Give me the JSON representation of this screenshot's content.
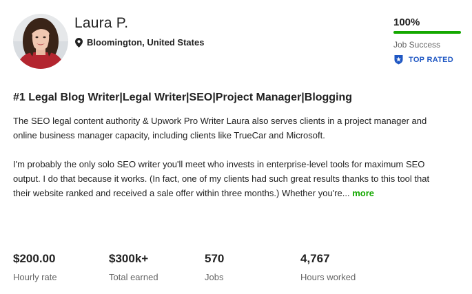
{
  "profile": {
    "name": "Laura P.",
    "location": "Bloomington, United States",
    "avatar_icon": "profile-photo"
  },
  "job_success": {
    "value_label": "100%",
    "percent": 100,
    "label": "Job Success",
    "bar_color": "#14a800"
  },
  "badge": {
    "label": "TOP RATED",
    "icon": "top-rated-shield-icon",
    "color": "#1f57c3"
  },
  "headline": "#1 Legal Blog Writer|Legal Writer|SEO|Project Manager|Blogging",
  "overview": {
    "paragraph1": "The SEO legal content authority & Upwork Pro Writer Laura also serves clients in a project manager and online business manager capacity, including clients like TrueCar and Microsoft.",
    "paragraph2": "I'm probably the only solo SEO writer you'll meet who invests in enterprise-level tools for maximum SEO output. I do that because it works. (In fact, one of my clients had such great results thanks to this tool that their website ranked and received a sale offer within three months.) Whether you're...",
    "more_label": "more",
    "link_color": "#14a800"
  },
  "stats": [
    {
      "value": "$200.00",
      "label": "Hourly rate"
    },
    {
      "value": "$300k+",
      "label": "Total earned"
    },
    {
      "value": "570",
      "label": "Jobs"
    },
    {
      "value": "4,767",
      "label": "Hours worked"
    }
  ]
}
